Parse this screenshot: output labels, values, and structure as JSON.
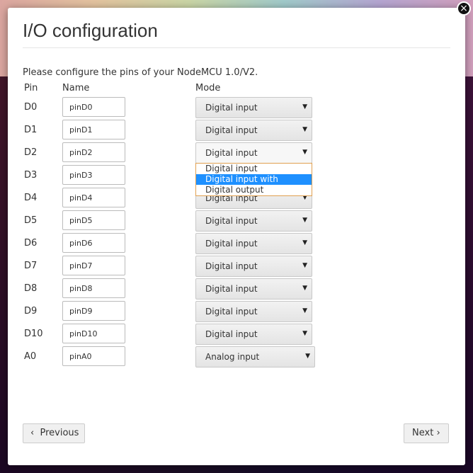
{
  "dialog": {
    "title": "I/O configuration",
    "close_glyph": "×",
    "intro": "Please configure the pins of your NodeMCU 1.0/V2."
  },
  "table": {
    "headers": {
      "pin": "Pin",
      "name": "Name",
      "mode": "Mode"
    },
    "rows": [
      {
        "pin": "D0",
        "name": "pinD0",
        "mode": "Digital input"
      },
      {
        "pin": "D1",
        "name": "pinD1",
        "mode": "Digital input"
      },
      {
        "pin": "D2",
        "name": "pinD2",
        "mode": "Digital input"
      },
      {
        "pin": "D3",
        "name": "pinD3",
        "mode": "Digital input"
      },
      {
        "pin": "D4",
        "name": "pinD4",
        "mode": "Digital input"
      },
      {
        "pin": "D5",
        "name": "pinD5",
        "mode": "Digital input"
      },
      {
        "pin": "D6",
        "name": "pinD6",
        "mode": "Digital input"
      },
      {
        "pin": "D7",
        "name": "pinD7",
        "mode": "Digital input"
      },
      {
        "pin": "D8",
        "name": "pinD8",
        "mode": "Digital input"
      },
      {
        "pin": "D9",
        "name": "pinD9",
        "mode": "Digital input"
      },
      {
        "pin": "D10",
        "name": "pinD10",
        "mode": "Digital input"
      },
      {
        "pin": "A0",
        "name": "pinA0",
        "mode": "Analog input"
      }
    ]
  },
  "dropdown": {
    "open_row": "D2",
    "options": [
      "Digital input",
      "Digital input with trigger",
      "Digital output"
    ],
    "highlighted": "Digital input with trigger"
  },
  "buttons": {
    "previous": "Previous",
    "next": "Next"
  },
  "icons": {
    "select_arrow": "chevron-down-icon",
    "prev": "chevron-left-icon",
    "next": "chevron-right-icon"
  },
  "colors": {
    "highlight": "#1e90ff",
    "dropdown_border": "#e0a050"
  }
}
